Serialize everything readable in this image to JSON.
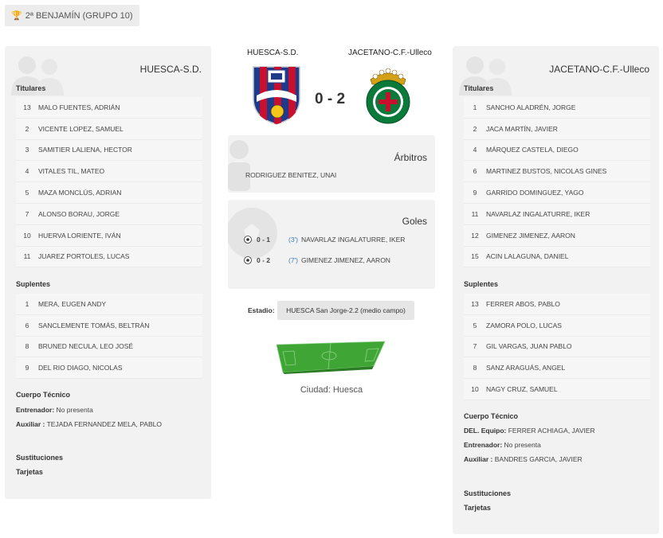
{
  "competition": {
    "icon": "trophy-icon",
    "label": "2ª BENJAMÍN (GRUPO 10)"
  },
  "match": {
    "home_name": "HUESCA-S.D.",
    "away_name": "JACETANO-C.F.-Ulleco",
    "score": "0 - 2"
  },
  "home": {
    "team_name": "HUESCA-S.D.",
    "titulares_label": "Titulares",
    "titulares": [
      {
        "num": "13",
        "name": "MALO FUENTES, ADRIÁN"
      },
      {
        "num": "2",
        "name": "VICENTE LOPEZ, SAMUEL"
      },
      {
        "num": "3",
        "name": "SAMITIER LALIENA, HECTOR"
      },
      {
        "num": "4",
        "name": "VITALES TIL, MATEO"
      },
      {
        "num": "5",
        "name": "MAZA MONCLÚS, ADRIAN"
      },
      {
        "num": "7",
        "name": "ALONSO BORAU, JORGE"
      },
      {
        "num": "10",
        "name": "HUERVA LORIENTE, IVÁN"
      },
      {
        "num": "11",
        "name": "JUAREZ PORTOLES, LUCAS"
      }
    ],
    "suplentes_label": "Suplentes",
    "suplentes": [
      {
        "num": "1",
        "name": "MERA, EUGEN ANDY"
      },
      {
        "num": "6",
        "name": "SANCLEMENTE TOMÁS, BELTRÁN"
      },
      {
        "num": "8",
        "name": "BRUNED NECULA, LEO JOSÉ"
      },
      {
        "num": "9",
        "name": "DEL RIO DIAGO, NICOLAS"
      }
    ],
    "cuerpo_label": "Cuerpo Técnico",
    "staff": [
      {
        "role": "Entrenador:",
        "name": "No presenta"
      },
      {
        "role": "Auxiliar :",
        "name": "TEJADA FERNANDEZ MELA, PABLO"
      }
    ],
    "sustituciones_label": "Sustituciones",
    "tarjetas_label": "Tarjetas"
  },
  "away": {
    "team_name": "JACETANO-C.F.-Ulleco",
    "titulares_label": "Titulares",
    "titulares": [
      {
        "num": "1",
        "name": "SANCHO ALADRÉN, JORGE"
      },
      {
        "num": "2",
        "name": "JACA MARTÍN, JAVIER"
      },
      {
        "num": "4",
        "name": "MÁRQUEZ CASTELA, DIEGO"
      },
      {
        "num": "6",
        "name": "MARTINEZ BUSTOS, NICOLAS GINES"
      },
      {
        "num": "9",
        "name": "GARRIDO DOMINGUEZ, YAGO"
      },
      {
        "num": "11",
        "name": "NAVARLAZ INGALATURRE, IKER"
      },
      {
        "num": "12",
        "name": "GIMENEZ JIMENEZ, AARON"
      },
      {
        "num": "15",
        "name": "ACIN LALAGUNA, DANIEL"
      }
    ],
    "suplentes_label": "Suplentes",
    "suplentes": [
      {
        "num": "13",
        "name": "FERRER ABOS, PABLO"
      },
      {
        "num": "5",
        "name": "ZAMORA POLO, LUCAS"
      },
      {
        "num": "7",
        "name": "GIL VARGAS, JUAN PABLO"
      },
      {
        "num": "8",
        "name": "SANZ ARAGUÁS, ANGEL"
      },
      {
        "num": "10",
        "name": "NAGY CRUZ, SAMUEL"
      }
    ],
    "cuerpo_label": "Cuerpo Técnico",
    "staff": [
      {
        "role": "DEL. Equipo:",
        "name": "FERRER ACHIAGA, JAVIER"
      },
      {
        "role": "Entrenador:",
        "name": "No presenta"
      },
      {
        "role": "Auxiliar :",
        "name": "BANDRES GARCIA, JAVIER"
      }
    ],
    "sustituciones_label": "Sustituciones",
    "tarjetas_label": "Tarjetas"
  },
  "arbitros": {
    "title": "Árbitros",
    "referee": "RODRIGUEZ BENITEZ, UNAI"
  },
  "goles": {
    "title": "Goles",
    "items": [
      {
        "score": "0 - 1",
        "minute": "(3')",
        "scorer": "NAVARLAZ INGALATURRE, IKER"
      },
      {
        "score": "0 - 2",
        "minute": "(7')",
        "scorer": "GIMENEZ JIMENEZ, AARON"
      }
    ]
  },
  "venue": {
    "estadio_label": "Estadio:",
    "estadio": "HUESCA San Jorge-2.2 (medio campo)",
    "ciudad": "Ciudad: Huesca"
  },
  "colors": {
    "panel_bg": "#f2f2f2",
    "pitch_green": "#3fa535",
    "minute_blue": "#3a7bbf",
    "huesca_blue": "#1f3a8a",
    "huesca_red": "#c8102e",
    "jacetano_green": "#0a7a3a"
  }
}
